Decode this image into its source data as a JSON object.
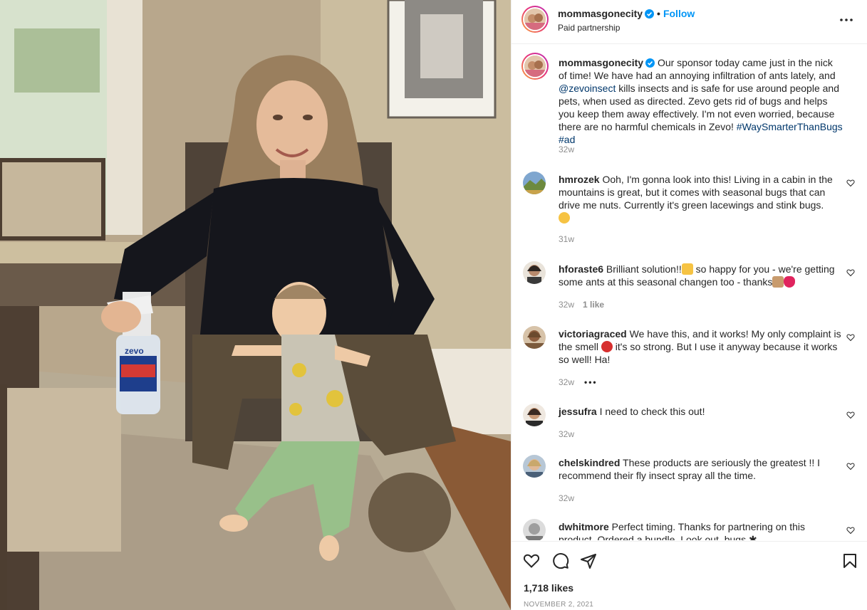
{
  "post": {
    "username": "mommasgonecity",
    "follow_label": "Follow",
    "separator": "•",
    "subtitle": "Paid partnership",
    "caption": {
      "text_1": "Our sponsor today came just in the nick of time! We have had an annoying infiltration of ants lately, and ",
      "mention": "@zevoinsect",
      "text_2": " kills insects and is safe for use around people and pets, when used as directed. Zevo gets rid of bugs and helps you keep them away effectively. I'm not even worried, because there are no harmful chemicals in Zevo! ",
      "hashtag_1": "#WaySmarterThanBugs",
      "hashtag_2": "#ad",
      "time": "32w"
    },
    "product_label": "zevo",
    "likes": "1,718 likes",
    "date": "NOVEMBER 2, 2021"
  },
  "comments": [
    {
      "user": "hmrozek",
      "text_1": "Ooh, I'm gonna look into this! Living in a cabin in the mountains is great, but it comes with seasonal bugs that can drive me nuts. Currently it's green lacewings and stink bugs.",
      "time": "31w"
    },
    {
      "user": "hforaste6",
      "text_1": "Brilliant solution!!",
      "text_2": " so happy for you - we're getting some ants at this seasonal changen too - thanks",
      "time": "32w",
      "likes_label": "1 like"
    },
    {
      "user": "victoriagraced",
      "text_1": "We have this, and it works! My only complaint is the smell ",
      "text_2": " it's so strong. But I use it anyway because it works so well! Ha!",
      "time": "32w",
      "more": "•••"
    },
    {
      "user": "jessufra",
      "text_1": "I need to check this out!",
      "time": "32w"
    },
    {
      "user": "chelskindred",
      "text_1": "These products are seriously the greatest !! I recommend their fly insect spray all the time.",
      "time": "32w"
    },
    {
      "user": "dwhitmore",
      "text_1": "Perfect timing. Thanks for partnering on this product. Ordered a bundle. Look out, bugs ",
      "time": ""
    }
  ],
  "icons": {
    "verified": "verified-badge-icon",
    "more": "more-options-icon",
    "like": "heart-icon",
    "comment": "comment-icon",
    "share": "share-icon",
    "save": "bookmark-icon"
  },
  "colors": {
    "link": "#00376b",
    "follow": "#0095f6",
    "muted": "#8e8e8e",
    "verified": "#0095f6"
  }
}
